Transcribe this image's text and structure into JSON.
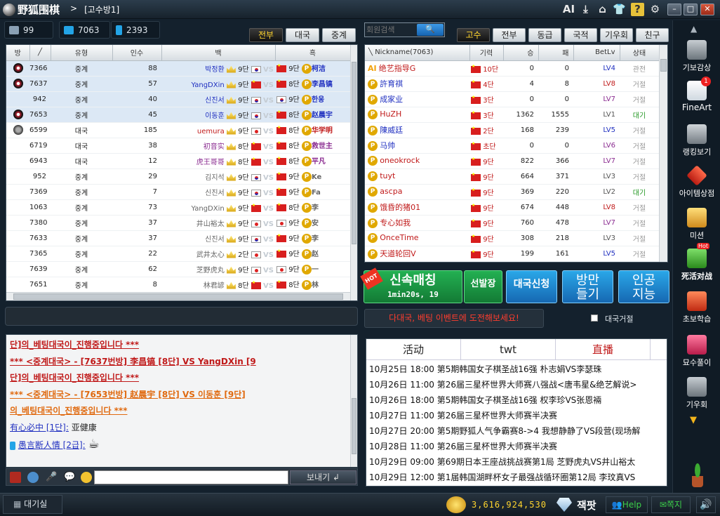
{
  "titlebar": {
    "app_name": "野狐围棋",
    "room": "[고수방1]",
    "ai_label": "AI"
  },
  "stats": {
    "coins": "99",
    "pc_users": "7063",
    "mobile_users": "2393"
  },
  "game_tabs": [
    "전부",
    "대국",
    "중계"
  ],
  "game_table": {
    "headers": [
      "방",
      "╱",
      "유형",
      "인수",
      "백",
      "흑"
    ],
    "rows": [
      {
        "room": "7366",
        "type": "중계",
        "count": "88",
        "white": "박정환",
        "wrank": "9단",
        "black": "柯洁",
        "brank": "9단",
        "icon": "x",
        "wc": "k",
        "bc": "c",
        "sel": true,
        "wcolor": "#2030c0",
        "bcolor": "#2030c0"
      },
      {
        "room": "7637",
        "type": "중계",
        "count": "57",
        "white": "YangDXin",
        "wrank": "9단",
        "black": "李昌镐",
        "brank": "8단",
        "icon": "x",
        "wc": "c",
        "bc": "c",
        "sel": true,
        "wcolor": "#2030c0",
        "bcolor": "#2030c0"
      },
      {
        "room": "942",
        "type": "중계",
        "count": "40",
        "white": "신진서",
        "wrank": "9단",
        "black": "한웅",
        "brank": "9단",
        "icon": "",
        "wc": "k",
        "bc": "k",
        "sel": true,
        "wcolor": "#2030c0",
        "bcolor": "#2030c0"
      },
      {
        "room": "7653",
        "type": "중계",
        "count": "45",
        "white": "이동훈",
        "wrank": "9단",
        "black": "赵晨宇",
        "brank": "8단",
        "icon": "x",
        "wc": "k",
        "bc": "c",
        "sel": true,
        "wcolor": "#2030c0",
        "bcolor": "#2030c0"
      },
      {
        "room": "6599",
        "type": "대국",
        "count": "185",
        "white": "uemura",
        "wrank": "9단",
        "black": "华学明",
        "brank": "8단",
        "icon": "o",
        "wc": "j",
        "bc": "c",
        "sel": false,
        "wcolor": "#c01a1a",
        "bcolor": "#c01a1a"
      },
      {
        "room": "6719",
        "type": "대국",
        "count": "38",
        "white": "初音实",
        "wrank": "8단",
        "black": "救世主",
        "brank": "8단",
        "icon": "",
        "wc": "c",
        "bc": "c",
        "sel": false,
        "wcolor": "#8a2b90",
        "bcolor": "#8a2b90"
      },
      {
        "room": "6943",
        "type": "대국",
        "count": "12",
        "white": "虎王哥哥",
        "wrank": "8단",
        "black": "平凡",
        "brank": "8단",
        "icon": "",
        "wc": "c",
        "bc": "c",
        "sel": false,
        "wcolor": "#8a2b90",
        "bcolor": "#8a2b90"
      },
      {
        "room": "952",
        "type": "중계",
        "count": "29",
        "white": "김지석",
        "wrank": "9단",
        "black": "Ke",
        "brank": "9단",
        "icon": "",
        "wc": "k",
        "bc": "c",
        "sel": false,
        "wcolor": "#666",
        "bcolor": "#666"
      },
      {
        "room": "7369",
        "type": "중계",
        "count": "7",
        "white": "신진서",
        "wrank": "9단",
        "black": "Fa",
        "brank": "9단",
        "icon": "",
        "wc": "k",
        "bc": "c",
        "sel": false,
        "wcolor": "#666",
        "bcolor": "#666"
      },
      {
        "room": "1063",
        "type": "중계",
        "count": "73",
        "white": "YangDXin",
        "wrank": "9단",
        "black": "李",
        "brank": "8단",
        "icon": "",
        "wc": "c",
        "bc": "c",
        "sel": false,
        "wcolor": "#666",
        "bcolor": "#666"
      },
      {
        "room": "7380",
        "type": "중계",
        "count": "37",
        "white": "井山裕太",
        "wrank": "9단",
        "black": "安",
        "brank": "9단",
        "icon": "",
        "wc": "j",
        "bc": "j",
        "sel": false,
        "wcolor": "#666",
        "bcolor": "#666"
      },
      {
        "room": "7633",
        "type": "중계",
        "count": "37",
        "white": "신진서",
        "wrank": "9단",
        "black": "李",
        "brank": "9단",
        "icon": "",
        "wc": "k",
        "bc": "c",
        "sel": false,
        "wcolor": "#666",
        "bcolor": "#666"
      },
      {
        "room": "7365",
        "type": "중계",
        "count": "22",
        "white": "武井太心",
        "wrank": "2단",
        "black": "赵",
        "brank": "9단",
        "icon": "",
        "wc": "j",
        "bc": "c",
        "sel": false,
        "wcolor": "#666",
        "bcolor": "#666"
      },
      {
        "room": "7639",
        "type": "중계",
        "count": "62",
        "white": "芝野虎丸",
        "wrank": "9단",
        "black": "一",
        "brank": "9단",
        "icon": "",
        "wc": "j",
        "bc": "j",
        "sel": false,
        "wcolor": "#666",
        "bcolor": "#666"
      },
      {
        "room": "7651",
        "type": "중계",
        "count": "8",
        "white": "林君諺",
        "wrank": "8단",
        "black": "林",
        "brank": "8단",
        "icon": "",
        "wc": "c",
        "bc": "c",
        "sel": false,
        "wcolor": "#666",
        "bcolor": "#666"
      }
    ]
  },
  "search": {
    "placeholder": "회원검색"
  },
  "player_tabs": [
    "고수",
    "전부",
    "동급",
    "국적",
    "기우회",
    "친구"
  ],
  "player_table": {
    "headers": [
      "Nickname(7063)",
      "기력",
      "승",
      "패",
      "BetLv",
      "상태"
    ],
    "rows": [
      {
        "name": "绝艺指导G",
        "rank": "10단",
        "w": "0",
        "l": "0",
        "lv": "LV4",
        "st": "관전",
        "ai": true,
        "nc": "#c01a1a",
        "lvc": "#2030c0"
      },
      {
        "name": "許育祺",
        "rank": "4단",
        "w": "4",
        "l": "8",
        "lv": "LV8",
        "st": "거절",
        "ai": false,
        "nc": "#2030c0",
        "lvc": "#c01a1a"
      },
      {
        "name": "成家业",
        "rank": "3단",
        "w": "0",
        "l": "0",
        "lv": "LV7",
        "st": "거절",
        "ai": false,
        "nc": "#2030c0",
        "lvc": "#8a2b90"
      },
      {
        "name": "HuZH",
        "rank": "3단",
        "w": "1362",
        "l": "1555",
        "lv": "LV1",
        "st": "대기",
        "ai": false,
        "nc": "#c01a1a",
        "lvc": "#555"
      },
      {
        "name": "陳威廷",
        "rank": "2단",
        "w": "168",
        "l": "239",
        "lv": "LV5",
        "st": "거절",
        "ai": false,
        "nc": "#2030c0",
        "lvc": "#2030c0"
      },
      {
        "name": "马帅",
        "rank": "초단",
        "w": "0",
        "l": "0",
        "lv": "LV6",
        "st": "거절",
        "ai": false,
        "nc": "#2030c0",
        "lvc": "#8a2b90"
      },
      {
        "name": "oneokrock",
        "rank": "9단",
        "w": "822",
        "l": "366",
        "lv": "LV7",
        "st": "거절",
        "ai": false,
        "nc": "#c01a1a",
        "lvc": "#8a2b90"
      },
      {
        "name": "tuyt",
        "rank": "9단",
        "w": "664",
        "l": "371",
        "lv": "LV3",
        "st": "거절",
        "ai": false,
        "nc": "#c01a1a",
        "lvc": "#555"
      },
      {
        "name": "ascpa",
        "rank": "9단",
        "w": "369",
        "l": "220",
        "lv": "LV2",
        "st": "대기",
        "ai": false,
        "nc": "#c01a1a",
        "lvc": "#555"
      },
      {
        "name": "饿昏的猪01",
        "rank": "9단",
        "w": "674",
        "l": "448",
        "lv": "LV8",
        "st": "거절",
        "ai": false,
        "nc": "#c01a1a",
        "lvc": "#c01a1a"
      },
      {
        "name": "专心如我",
        "rank": "9단",
        "w": "760",
        "l": "478",
        "lv": "LV7",
        "st": "거절",
        "ai": false,
        "nc": "#c01a1a",
        "lvc": "#8a2b90"
      },
      {
        "name": "OnceTime",
        "rank": "9단",
        "w": "308",
        "l": "218",
        "lv": "LV3",
        "st": "거절",
        "ai": false,
        "nc": "#c01a1a",
        "lvc": "#555"
      },
      {
        "name": "天道轮回V",
        "rank": "9단",
        "w": "199",
        "l": "161",
        "lv": "LV5",
        "st": "거절",
        "ai": false,
        "nc": "#c01a1a",
        "lvc": "#2030c0"
      }
    ]
  },
  "big_buttons": {
    "hot": "HOT",
    "fast_match": "신속매칭",
    "fast_time": "1min20s, 19",
    "first_move": "선발장",
    "apply": "대국신청",
    "room_make_1": "방만",
    "room_make_2": "들기",
    "ai_1": "인공",
    "ai_2": "지능"
  },
  "event_text": "다대국, 베팅 이벤트에 도전해보세요!",
  "reject_label": "대국거절",
  "chat": {
    "lines": [
      {
        "t": "단]의_베팅대국이_진행중입니다 ***",
        "c": "#c01a1a"
      },
      {
        "t": "*** <중계대국> - [7637번방] 李昌镐 [8단] VS YangDXin [9",
        "c": "#c01a1a"
      },
      {
        "t": "단]의_베팅대국이_진행중입니다 ***",
        "c": "#c01a1a"
      },
      {
        "t": "*** <중계대국> - [7653번방] 赵晨宇 [8단] VS 이동훈 [9단]",
        "c": "#e06a10"
      },
      {
        "t": "의_베팅대국이_진행중입니다 ***",
        "c": "#e06a10"
      }
    ],
    "user1": "有心必中 [1단]:",
    "msg1": "亚健康",
    "user2": "愚言断人情 [2급]:",
    "send": "보내기"
  },
  "news": {
    "tabs": [
      "活动",
      "twt",
      "直播"
    ],
    "items": [
      "10月25日 18:00 第5期韩国女子棋圣战16强 朴志娟VS李瑟珠",
      "10月26日 11:00 第26届三星杯世界大师赛八强战<唐韦星&绝艺解说>",
      "10月26日 18:00 第5期韩国女子棋圣战16强 权李珍VS张恩裲",
      "10月27日 11:00 第26届三星杯世界大师赛半决赛",
      "10月27日 20:00 第5期野狐人气争霸赛8->4 我想静静了VS段营(现场解",
      "10月28日 11:00 第26届三星杯世界大师赛半决赛",
      "10月29日 09:00 第69期日本王座战挑战赛第1局 芝野虎丸VS井山裕太",
      "10月29日 12:00 第1届韩国湖畔杯女子最强战循环圈第12局 李玟真VS"
    ]
  },
  "sidebar": {
    "items": [
      "기보감상",
      "FineArt",
      "랭킹보기",
      "아이템상점",
      "미션",
      "死活对战",
      "초보학습",
      "묘수풀이",
      "기우회"
    ],
    "badge": "1",
    "hot": "Hot"
  },
  "bottom": {
    "lobby": "대기실",
    "money": "3,616,924,530",
    "jackpot": "잭팟",
    "help": "Help",
    "mail": "쪽지"
  }
}
